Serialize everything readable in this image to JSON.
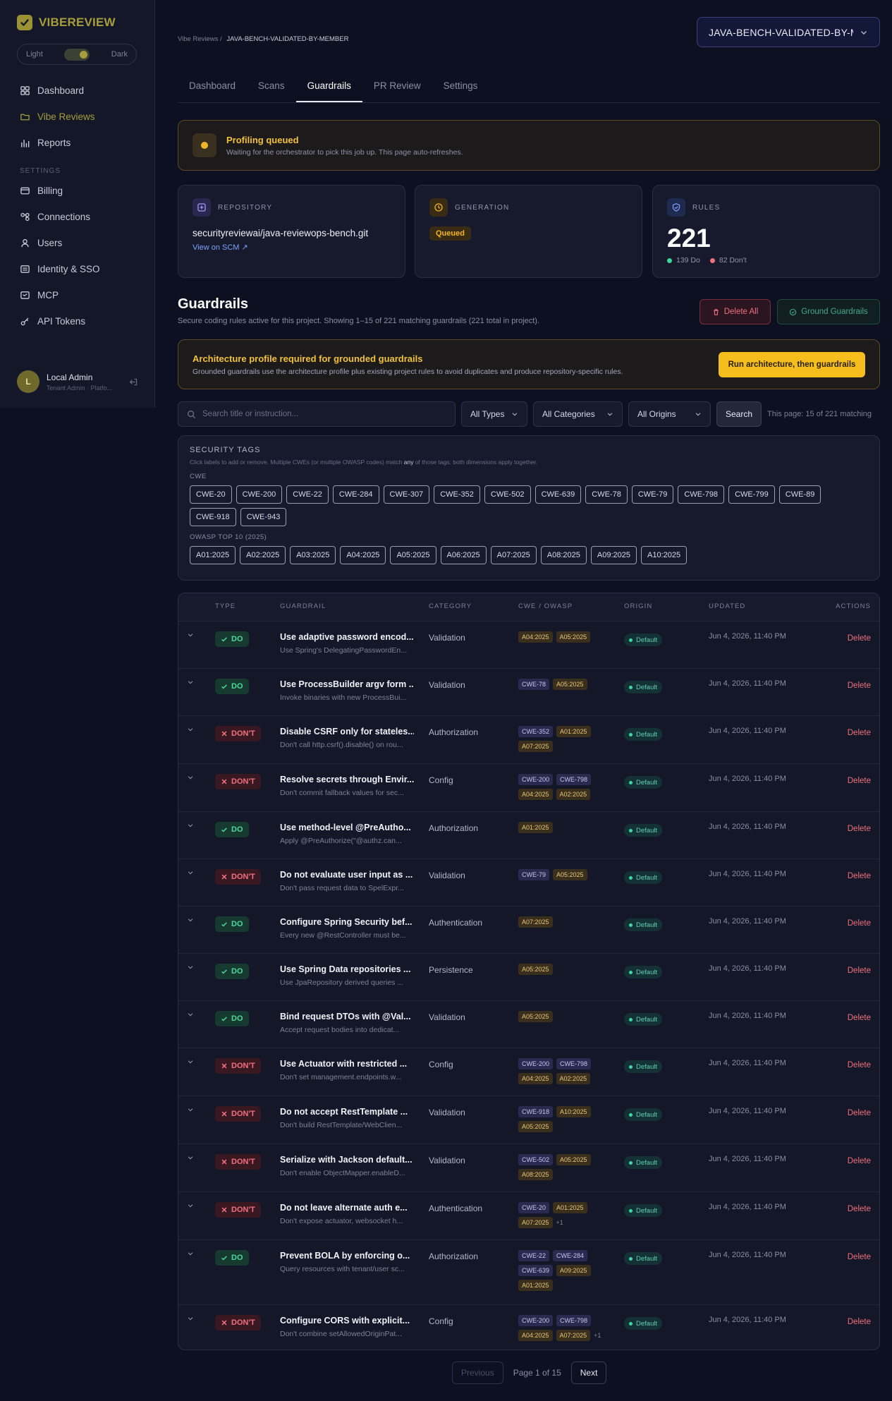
{
  "brand": {
    "name": "VIBEREVIEW"
  },
  "theme": {
    "light": "Light",
    "dark": "Dark"
  },
  "nav": {
    "main": [
      {
        "label": "Dashboard",
        "icon": "grid-icon"
      },
      {
        "label": "Vibe Reviews",
        "icon": "folder-icon",
        "active": true
      },
      {
        "label": "Reports",
        "icon": "bar-chart-icon"
      }
    ],
    "settings_title": "SETTINGS",
    "settings": [
      {
        "label": "Billing",
        "icon": "card-icon"
      },
      {
        "label": "Connections",
        "icon": "link-icon"
      },
      {
        "label": "Users",
        "icon": "user-icon"
      },
      {
        "label": "Identity & SSO",
        "icon": "id-icon"
      },
      {
        "label": "MCP",
        "icon": "mcp-icon"
      },
      {
        "label": "API Tokens",
        "icon": "key-icon"
      }
    ]
  },
  "user": {
    "initial": "L",
    "name": "Local Admin",
    "role": "Tenant Admin · Platfo..."
  },
  "breadcrumb": {
    "root": "Vibe Reviews",
    "sep": "/",
    "current": "JAVA-BENCH-VALIDATED-BY-MEMBER"
  },
  "project_select": {
    "value": "JAVA-BENCH-VALIDATED-BY-MEMBER"
  },
  "tabs": [
    "Dashboard",
    "Scans",
    "Guardrails",
    "PR Review",
    "Settings"
  ],
  "active_tab": "Guardrails",
  "banner": {
    "title": "Profiling queued",
    "subtitle": "Waiting for the orchestrator to pick this job up. This page auto-refreshes."
  },
  "cards": {
    "repository": {
      "label": "REPOSITORY",
      "value": "securityreviewai/java-reviewops-bench.git",
      "link": "View on SCM ↗"
    },
    "generation": {
      "label": "GENERATION",
      "status": "Queued"
    },
    "rules": {
      "label": "RULES",
      "count": "221",
      "do": "139 Do",
      "dont": "82 Don't"
    }
  },
  "guardrails": {
    "title": "Guardrails",
    "subtitle": "Secure coding rules active for this project. Showing 1–15 of 221 matching guardrails (221 total in project).",
    "delete_all": "Delete All",
    "ground": "Ground Guardrails"
  },
  "arch": {
    "title": "Architecture profile required for grounded guardrails",
    "subtitle": "Grounded guardrails use the architecture profile plus existing project rules to avoid duplicates and produce repository-specific rules.",
    "button": "Run architecture, then guardrails"
  },
  "filters": {
    "search_placeholder": "Search title or instruction...",
    "types": "All Types",
    "categories": "All Categories",
    "origins": "All Origins",
    "search_button": "Search",
    "page_info": "This page: 15 of 221 matching"
  },
  "tags": {
    "title": "SECURITY TAGS",
    "help_a": "Click labels to add or remove. Multiple CWEs (or multiple OWASP codes) match ",
    "help_b": "any",
    "help_c": " of those tags; both dimensions apply together.",
    "cwe_label": "CWE",
    "cwe": [
      "CWE-20",
      "CWE-200",
      "CWE-22",
      "CWE-284",
      "CWE-307",
      "CWE-352",
      "CWE-502",
      "CWE-639",
      "CWE-78",
      "CWE-79",
      "CWE-798",
      "CWE-799",
      "CWE-89",
      "CWE-918",
      "CWE-943"
    ],
    "owasp_label": "OWASP TOP 10 (2025)",
    "owasp": [
      "A01:2025",
      "A02:2025",
      "A03:2025",
      "A04:2025",
      "A05:2025",
      "A06:2025",
      "A07:2025",
      "A08:2025",
      "A09:2025",
      "A10:2025"
    ]
  },
  "table": {
    "headers": {
      "type": "TYPE",
      "guardrail": "GUARDRAIL",
      "category": "CATEGORY",
      "codes": "CWE / OWASP",
      "origin": "ORIGIN",
      "updated": "UPDATED",
      "actions": "ACTIONS"
    },
    "rows": [
      {
        "type": "DO",
        "title": "Use adaptive password encod...",
        "sub": "Use Spring's DelegatingPasswordEn...",
        "category": "Validation",
        "cwe": [],
        "owasp": [
          "A04:2025",
          "A05:2025"
        ],
        "more": "",
        "origin": "Default",
        "updated": "Jun 4, 2026, 11:40 PM",
        "action": "Delete"
      },
      {
        "type": "DO",
        "title": "Use ProcessBuilder argv form ...",
        "sub": "Invoke binaries with new ProcessBui...",
        "category": "Validation",
        "cwe": [
          "CWE-78"
        ],
        "owasp": [
          "A05:2025"
        ],
        "more": "",
        "origin": "Default",
        "updated": "Jun 4, 2026, 11:40 PM",
        "action": "Delete"
      },
      {
        "type": "DON'T",
        "title": "Disable CSRF only for stateles...",
        "sub": "Don't call http.csrf().disable() on rou...",
        "category": "Authorization",
        "cwe": [
          "CWE-352"
        ],
        "owasp": [
          "A01:2025",
          "A07:2025"
        ],
        "more": "",
        "origin": "Default",
        "updated": "Jun 4, 2026, 11:40 PM",
        "action": "Delete"
      },
      {
        "type": "DON'T",
        "title": "Resolve secrets through Envir...",
        "sub": "Don't commit fallback values for sec...",
        "category": "Config",
        "cwe": [
          "CWE-200",
          "CWE-798"
        ],
        "owasp": [
          "A04:2025",
          "A02:2025"
        ],
        "more": "",
        "origin": "Default",
        "updated": "Jun 4, 2026, 11:40 PM",
        "action": "Delete"
      },
      {
        "type": "DO",
        "title": "Use method-level @PreAutho...",
        "sub": "Apply @PreAuthorize(\"@authz.can...",
        "category": "Authorization",
        "cwe": [],
        "owasp": [
          "A01:2025"
        ],
        "more": "",
        "origin": "Default",
        "updated": "Jun 4, 2026, 11:40 PM",
        "action": "Delete"
      },
      {
        "type": "DON'T",
        "title": "Do not evaluate user input as ...",
        "sub": "Don't pass request data to SpelExpr...",
        "category": "Validation",
        "cwe": [
          "CWE-79"
        ],
        "owasp": [
          "A05:2025"
        ],
        "more": "",
        "origin": "Default",
        "updated": "Jun 4, 2026, 11:40 PM",
        "action": "Delete"
      },
      {
        "type": "DO",
        "title": "Configure Spring Security bef...",
        "sub": "Every new @RestController must be...",
        "category": "Authentication",
        "cwe": [],
        "owasp": [
          "A07:2025"
        ],
        "more": "",
        "origin": "Default",
        "updated": "Jun 4, 2026, 11:40 PM",
        "action": "Delete"
      },
      {
        "type": "DO",
        "title": "Use Spring Data repositories ...",
        "sub": "Use JpaRepository derived queries ...",
        "category": "Persistence",
        "cwe": [],
        "owasp": [
          "A05:2025"
        ],
        "more": "",
        "origin": "Default",
        "updated": "Jun 4, 2026, 11:40 PM",
        "action": "Delete"
      },
      {
        "type": "DO",
        "title": "Bind request DTOs with @Val...",
        "sub": "Accept request bodies into dedicat...",
        "category": "Validation",
        "cwe": [],
        "owasp": [
          "A05:2025"
        ],
        "more": "",
        "origin": "Default",
        "updated": "Jun 4, 2026, 11:40 PM",
        "action": "Delete"
      },
      {
        "type": "DON'T",
        "title": "Use Actuator with restricted ...",
        "sub": "Don't set management.endpoints.w...",
        "category": "Config",
        "cwe": [
          "CWE-200",
          "CWE-798"
        ],
        "owasp": [
          "A04:2025",
          "A02:2025"
        ],
        "more": "",
        "origin": "Default",
        "updated": "Jun 4, 2026, 11:40 PM",
        "action": "Delete"
      },
      {
        "type": "DON'T",
        "title": "Do not accept RestTemplate ...",
        "sub": "Don't build RestTemplate/WebClien...",
        "category": "Validation",
        "cwe": [
          "CWE-918"
        ],
        "owasp": [
          "A10:2025",
          "A05:2025"
        ],
        "more": "",
        "origin": "Default",
        "updated": "Jun 4, 2026, 11:40 PM",
        "action": "Delete"
      },
      {
        "type": "DON'T",
        "title": "Serialize with Jackson default...",
        "sub": "Don't enable ObjectMapper.enableD...",
        "category": "Validation",
        "cwe": [
          "CWE-502"
        ],
        "owasp": [
          "A05:2025",
          "A08:2025"
        ],
        "more": "",
        "origin": "Default",
        "updated": "Jun 4, 2026, 11:40 PM",
        "action": "Delete"
      },
      {
        "type": "DON'T",
        "title": "Do not leave alternate auth e...",
        "sub": "Don't expose actuator, websocket h...",
        "category": "Authentication",
        "cwe": [
          "CWE-20"
        ],
        "owasp": [
          "A01:2025",
          "A07:2025"
        ],
        "more": "+1",
        "origin": "Default",
        "updated": "Jun 4, 2026, 11:40 PM",
        "action": "Delete"
      },
      {
        "type": "DO",
        "title": "Prevent BOLA by enforcing o...",
        "sub": "Query resources with tenant/user sc...",
        "category": "Authorization",
        "cwe": [
          "CWE-22",
          "CWE-284",
          "CWE-639"
        ],
        "owasp": [
          "A09:2025",
          "A01:2025"
        ],
        "more": "",
        "origin": "Default",
        "updated": "Jun 4, 2026, 11:40 PM",
        "action": "Delete"
      },
      {
        "type": "DON'T",
        "title": "Configure CORS with explicit...",
        "sub": "Don't combine setAllowedOriginPat...",
        "category": "Config",
        "cwe": [
          "CWE-200",
          "CWE-798"
        ],
        "owasp": [
          "A04:2025",
          "A07:2025"
        ],
        "more": "+1",
        "origin": "Default",
        "updated": "Jun 4, 2026, 11:40 PM",
        "action": "Delete"
      }
    ]
  },
  "pager": {
    "prev": "Previous",
    "info": "Page 1 of 15",
    "next": "Next"
  }
}
